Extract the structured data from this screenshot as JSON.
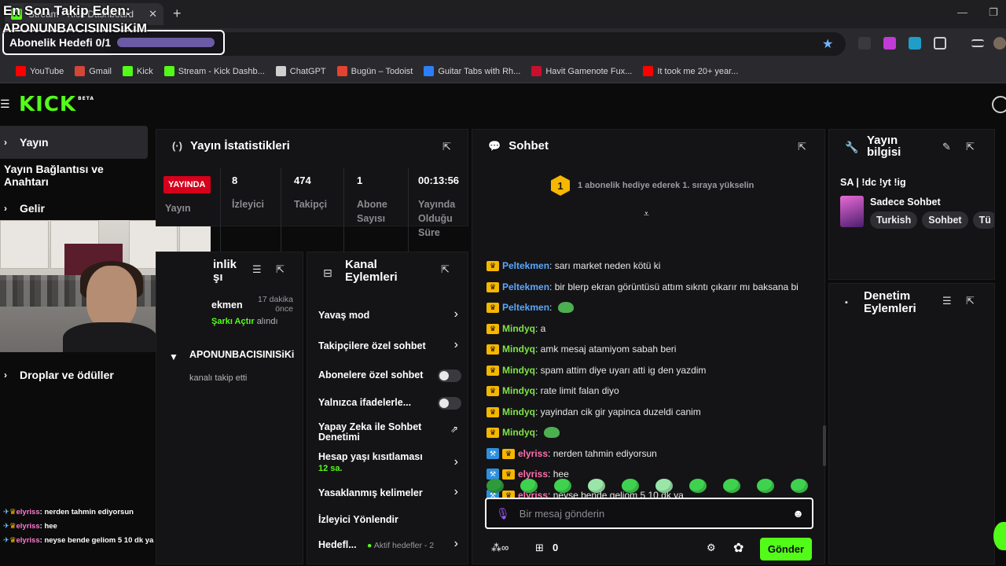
{
  "browser": {
    "tab_title": "Stream - Kick Dashboard",
    "bookmarks": [
      {
        "label": "YouTube",
        "color": "#ff0000"
      },
      {
        "label": "Gmail",
        "color": "#d44638"
      },
      {
        "label": "Kick",
        "color": "#53fc18"
      },
      {
        "label": "Stream - Kick Dashb...",
        "color": "#53fc18"
      },
      {
        "label": "ChatGPT",
        "color": "#cfcfcf"
      },
      {
        "label": "Bugün – Todoist",
        "color": "#e44332"
      },
      {
        "label": "Guitar Tabs with Rh...",
        "color": "#2d7ff9"
      },
      {
        "label": "Havit Gamenote Fux...",
        "color": "#c8102e"
      },
      {
        "label": "It took me 20+ year...",
        "color": "#ff0000"
      }
    ]
  },
  "overlay": {
    "last_follower_label": "En Son Takip Eden:",
    "last_follower_name": "APONUNBACISINISiKiM",
    "sub_goal": "Abonelik Hedefi 0/1"
  },
  "sidebar": {
    "items": [
      {
        "label": "Yayın"
      },
      {
        "label": "Yayın Bağlantısı ve Anahtarı"
      },
      {
        "label": "Gelir"
      },
      {
        "label": "Droplar ve ödüller"
      }
    ]
  },
  "mini_chat": [
    {
      "user": "elyriss",
      "text": "nerden tahmin ediyorsun"
    },
    {
      "user": "elyriss",
      "text": "hee"
    },
    {
      "user": "elyriss",
      "text": "neyse bende geliom 5 10 dk ya"
    }
  ],
  "stats": {
    "title": "Yayın İstatistikleri",
    "live_badge": "YAYINDA",
    "live_label": "Yayın",
    "viewers_value": "8",
    "viewers_label": "İzleyici",
    "followers_value": "474",
    "followers_label": "Takipçi",
    "subs_value": "1",
    "subs_label": "Abone Sayısı",
    "duration_value": "00:13:56",
    "duration_label": "Yayında Olduğu Süre"
  },
  "activity": {
    "title_part1": "inlik",
    "title_part2": "şı",
    "row1_name": "ekmen",
    "row1_time": "17 dakika önce",
    "row1_action_hl": "Şarkı Açtır",
    "row1_action_rest": "alındı",
    "row2_name": "APONUNBACISINISiKi",
    "row2_action": "kanalı takip etti"
  },
  "channel_actions": {
    "title_line1": "Kanal",
    "title_line2": "Eylemleri",
    "slow_mode": "Yavaş mod",
    "followers_only": "Takipçilere özel sohbet",
    "subs_only": "Abonelere özel sohbet",
    "emotes_only": "Yalnızca ifadelerle...",
    "ai_line1": "Yapay Zeka ile Sohbet",
    "ai_line2": "Denetimi",
    "account_age": "Hesap yaşı kısıtlaması",
    "account_age_value": "12 sa.",
    "banned_words": "Yasaklanmış kelimeler",
    "redirect": "İzleyici Yönlendir",
    "goals": "Hedefl...",
    "goals_active": "Aktif hedefler - 2"
  },
  "chat": {
    "title": "Sohbet",
    "gift_rank": "1",
    "gift_text": "1 abonelik hediye ederek 1. sıraya yükselin",
    "messages": [
      {
        "user": "Peltekmen",
        "text": "sarı market neden kötü ki"
      },
      {
        "user": "Peltekmen",
        "text": "bir blerp ekran görüntüsü attım sıkntı çıkarır mı baksana bi"
      },
      {
        "user": "Peltekmen",
        "text": ""
      },
      {
        "user": "Mindyq",
        "text": "a"
      },
      {
        "user": "Mindyq",
        "text": "amk mesaj atamiyom sabah beri"
      },
      {
        "user": "Mindyq",
        "text": "spam attim diye uyarı atti ig den yazdim"
      },
      {
        "user": "Mindyq",
        "text": "rate limit falan diyo"
      },
      {
        "user": "Mindyq",
        "text": "yayindan cik gir yapinca duzeldi canim"
      },
      {
        "user": "Mindyq",
        "text": ""
      },
      {
        "user": "elyriss",
        "text": "nerden tahmin ediyorsun"
      },
      {
        "user": "elyriss",
        "text": "hee"
      },
      {
        "user": "elyriss",
        "text": "neyse bende geliom 5 10 dk ya"
      }
    ],
    "input_placeholder": "Bir mesaj gönderin",
    "kicks_count": "0",
    "send_label": "Gönder"
  },
  "stream_info": {
    "title_line1": "Yayın",
    "title_line2": "bilgisi",
    "stream_title": "SA | !dc !yt !ig",
    "category": "Sadece Sohbet",
    "tags": [
      "Turkish",
      "Sohbet",
      "Tü"
    ]
  },
  "moderation": {
    "title_line1": "Denetim",
    "title_line2": "Eylemleri"
  },
  "colors": {
    "kick_green": "#53fc18",
    "live_red": "#d6001c",
    "crown_gold": "#f5b700"
  }
}
